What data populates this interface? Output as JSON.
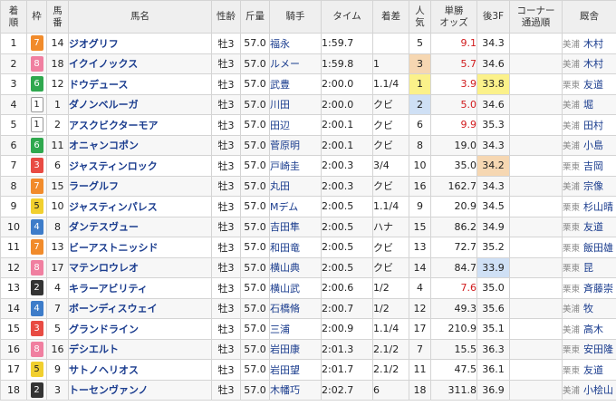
{
  "headers": {
    "rank": [
      "着",
      "順"
    ],
    "gate": "枠",
    "num": [
      "馬",
      "番"
    ],
    "horse": "馬名",
    "sexage": "性齢",
    "weight": "斤量",
    "jockey": "騎手",
    "time": "タイム",
    "margin": "着差",
    "pop": [
      "人",
      "気"
    ],
    "odds": [
      "単勝",
      "オッズ"
    ],
    "f3": "後3F",
    "corner": [
      "コーナー",
      "通過順"
    ],
    "trainer": "厩舎"
  },
  "rows": [
    {
      "rank": "1",
      "gate": "7",
      "num": "14",
      "horse": "ジオグリフ",
      "sexage": "牡3",
      "weight": "57.0",
      "jockey": "福永",
      "time": "1:59.7",
      "margin": "",
      "pop": "5",
      "odds": "9.1",
      "odds_red": true,
      "f3": "34.3",
      "loc": "美浦",
      "trainer": "木村"
    },
    {
      "rank": "2",
      "gate": "8",
      "num": "18",
      "horse": "イクイノックス",
      "sexage": "牡3",
      "weight": "57.0",
      "jockey": "ルメー",
      "time": "1:59.8",
      "margin": "1",
      "pop": "3",
      "odds": "5.7",
      "odds_red": true,
      "f3": "34.6",
      "loc": "美浦",
      "trainer": "木村"
    },
    {
      "rank": "3",
      "gate": "6",
      "num": "12",
      "horse": "ドウデュース",
      "sexage": "牡3",
      "weight": "57.0",
      "jockey": "武豊",
      "time": "2:00.0",
      "margin": "1.1/4",
      "pop": "1",
      "odds": "3.9",
      "odds_red": true,
      "f3": "33.8",
      "loc": "栗東",
      "trainer": "友道"
    },
    {
      "rank": "4",
      "gate": "1",
      "num": "1",
      "horse": "ダノンベルーガ",
      "sexage": "牡3",
      "weight": "57.0",
      "jockey": "川田",
      "time": "2:00.0",
      "margin": "クビ",
      "pop": "2",
      "odds": "5.0",
      "odds_red": true,
      "f3": "34.6",
      "loc": "美浦",
      "trainer": "堀"
    },
    {
      "rank": "5",
      "gate": "1",
      "num": "2",
      "horse": "アスクビクターモア",
      "sexage": "牡3",
      "weight": "57.0",
      "jockey": "田辺",
      "time": "2:00.1",
      "margin": "クビ",
      "pop": "6",
      "odds": "9.9",
      "odds_red": true,
      "f3": "35.3",
      "loc": "美浦",
      "trainer": "田村"
    },
    {
      "rank": "6",
      "gate": "6",
      "num": "11",
      "horse": "オニャンコポン",
      "sexage": "牡3",
      "weight": "57.0",
      "jockey": "菅原明",
      "time": "2:00.1",
      "margin": "クビ",
      "pop": "8",
      "odds": "19.0",
      "odds_red": false,
      "f3": "34.3",
      "loc": "美浦",
      "trainer": "小島"
    },
    {
      "rank": "7",
      "gate": "3",
      "num": "6",
      "horse": "ジャスティンロック",
      "sexage": "牡3",
      "weight": "57.0",
      "jockey": "戸崎圭",
      "time": "2:00.3",
      "margin": "3/4",
      "pop": "10",
      "odds": "35.0",
      "odds_red": false,
      "f3": "34.2",
      "loc": "栗東",
      "trainer": "吉岡"
    },
    {
      "rank": "8",
      "gate": "7",
      "num": "15",
      "horse": "ラーグルフ",
      "sexage": "牡3",
      "weight": "57.0",
      "jockey": "丸田",
      "time": "2:00.3",
      "margin": "クビ",
      "pop": "16",
      "odds": "162.7",
      "odds_red": false,
      "f3": "34.3",
      "loc": "美浦",
      "trainer": "宗像"
    },
    {
      "rank": "9",
      "gate": "5",
      "num": "10",
      "horse": "ジャスティンパレス",
      "sexage": "牡3",
      "weight": "57.0",
      "jockey": "Mデム",
      "time": "2:00.5",
      "margin": "1.1/4",
      "pop": "9",
      "odds": "20.9",
      "odds_red": false,
      "f3": "34.5",
      "loc": "栗東",
      "trainer": "杉山晴"
    },
    {
      "rank": "10",
      "gate": "4",
      "num": "8",
      "horse": "ダンテスヴュー",
      "sexage": "牡3",
      "weight": "57.0",
      "jockey": "吉田隼",
      "time": "2:00.5",
      "margin": "ハナ",
      "pop": "15",
      "odds": "86.2",
      "odds_red": false,
      "f3": "34.9",
      "loc": "栗東",
      "trainer": "友道"
    },
    {
      "rank": "11",
      "gate": "7",
      "num": "13",
      "horse": "ビーアストニッシド",
      "sexage": "牡3",
      "weight": "57.0",
      "jockey": "和田竜",
      "time": "2:00.5",
      "margin": "クビ",
      "pop": "13",
      "odds": "72.7",
      "odds_red": false,
      "f3": "35.2",
      "loc": "栗東",
      "trainer": "飯田雄"
    },
    {
      "rank": "12",
      "gate": "8",
      "num": "17",
      "horse": "マテンロウレオ",
      "sexage": "牡3",
      "weight": "57.0",
      "jockey": "横山典",
      "time": "2:00.5",
      "margin": "クビ",
      "pop": "14",
      "odds": "84.7",
      "odds_red": false,
      "f3": "33.9",
      "loc": "栗東",
      "trainer": "昆"
    },
    {
      "rank": "13",
      "gate": "2",
      "num": "4",
      "horse": "キラーアビリティ",
      "sexage": "牡3",
      "weight": "57.0",
      "jockey": "横山武",
      "time": "2:00.6",
      "margin": "1/2",
      "pop": "4",
      "odds": "7.6",
      "odds_red": true,
      "f3": "35.0",
      "loc": "栗東",
      "trainer": "斉藤崇"
    },
    {
      "rank": "14",
      "gate": "4",
      "num": "7",
      "horse": "ボーンディスウェイ",
      "sexage": "牡3",
      "weight": "57.0",
      "jockey": "石橋脩",
      "time": "2:00.7",
      "margin": "1/2",
      "pop": "12",
      "odds": "49.3",
      "odds_red": false,
      "f3": "35.6",
      "loc": "美浦",
      "trainer": "牧"
    },
    {
      "rank": "15",
      "gate": "3",
      "num": "5",
      "horse": "グランドライン",
      "sexage": "牡3",
      "weight": "57.0",
      "jockey": "三浦",
      "time": "2:00.9",
      "margin": "1.1/4",
      "pop": "17",
      "odds": "210.9",
      "odds_red": false,
      "f3": "35.1",
      "loc": "美浦",
      "trainer": "高木"
    },
    {
      "rank": "16",
      "gate": "8",
      "num": "16",
      "horse": "デシエルト",
      "sexage": "牡3",
      "weight": "57.0",
      "jockey": "岩田康",
      "time": "2:01.3",
      "margin": "2.1/2",
      "pop": "7",
      "odds": "15.5",
      "odds_red": false,
      "f3": "36.3",
      "loc": "栗東",
      "trainer": "安田隆"
    },
    {
      "rank": "17",
      "gate": "5",
      "num": "9",
      "horse": "サトノヘリオス",
      "sexage": "牡3",
      "weight": "57.0",
      "jockey": "岩田望",
      "time": "2:01.7",
      "margin": "2.1/2",
      "pop": "11",
      "odds": "47.5",
      "odds_red": false,
      "f3": "36.1",
      "loc": "栗東",
      "trainer": "友道"
    },
    {
      "rank": "18",
      "gate": "2",
      "num": "3",
      "horse": "トーセンヴァンノ",
      "sexage": "牡3",
      "weight": "57.0",
      "jockey": "木幡巧",
      "time": "2:02.7",
      "margin": "6",
      "pop": "18",
      "odds": "311.8",
      "odds_red": false,
      "f3": "36.9",
      "loc": "美浦",
      "trainer": "小桧山"
    }
  ],
  "highlights": {
    "pop_top": [
      "1",
      "2",
      "3"
    ],
    "f3_top": [
      "33.8",
      "33.9",
      "34.2"
    ]
  }
}
